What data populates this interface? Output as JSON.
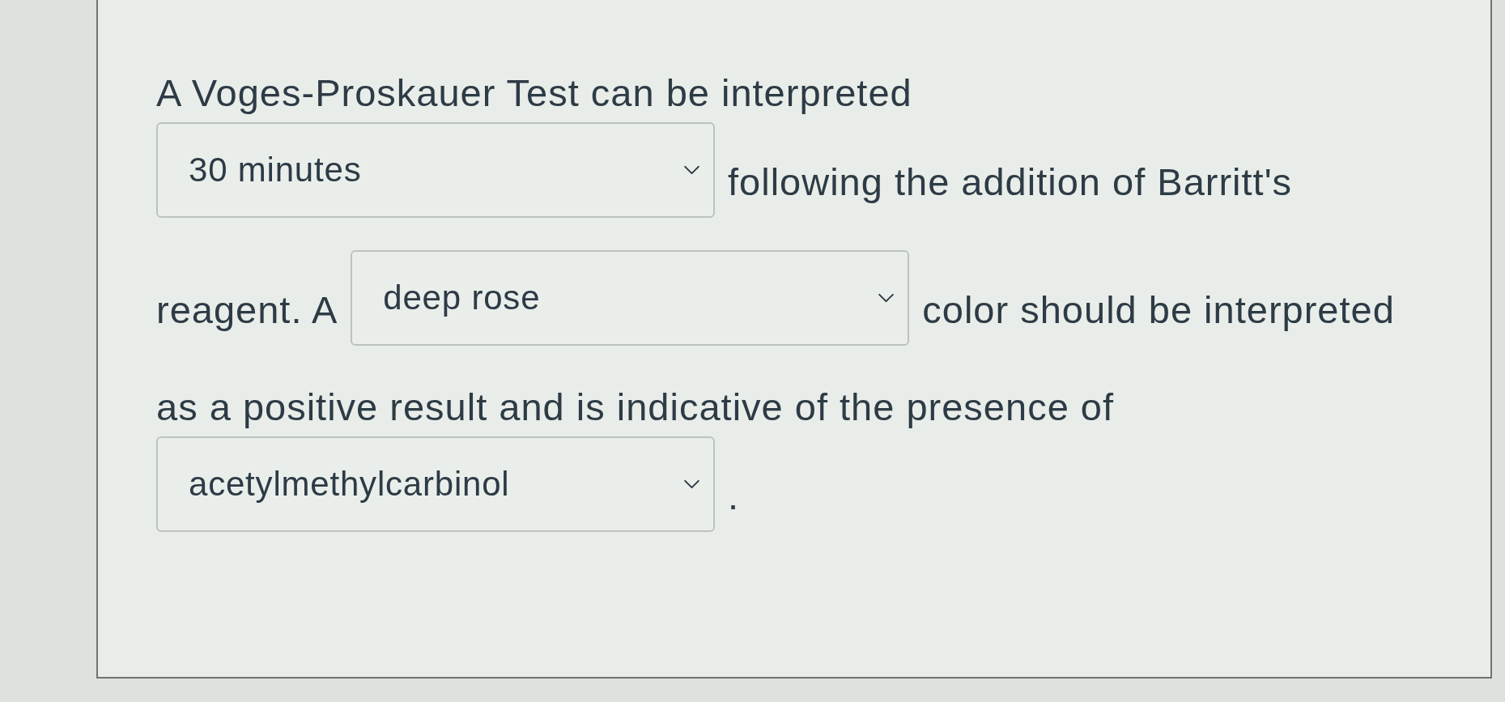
{
  "question": {
    "lines": [
      [
        {
          "kind": "text",
          "text": "A Voges-Proskauer Test can be interpreted"
        }
      ],
      [
        {
          "kind": "dropdown",
          "value": "30 minutes"
        },
        {
          "kind": "text",
          "text": "following the addition of Barritt's"
        }
      ],
      [
        {
          "kind": "text",
          "text": "reagent. A"
        },
        {
          "kind": "dropdown",
          "value": "deep rose"
        },
        {
          "kind": "text",
          "text": "color should be interpreted"
        }
      ],
      [
        {
          "kind": "text",
          "text": "as a positive result and is indicative of the presence of"
        }
      ],
      [
        {
          "kind": "dropdown",
          "value": "acetylmethylcarbinol"
        },
        {
          "kind": "text",
          "text": "."
        }
      ]
    ]
  }
}
